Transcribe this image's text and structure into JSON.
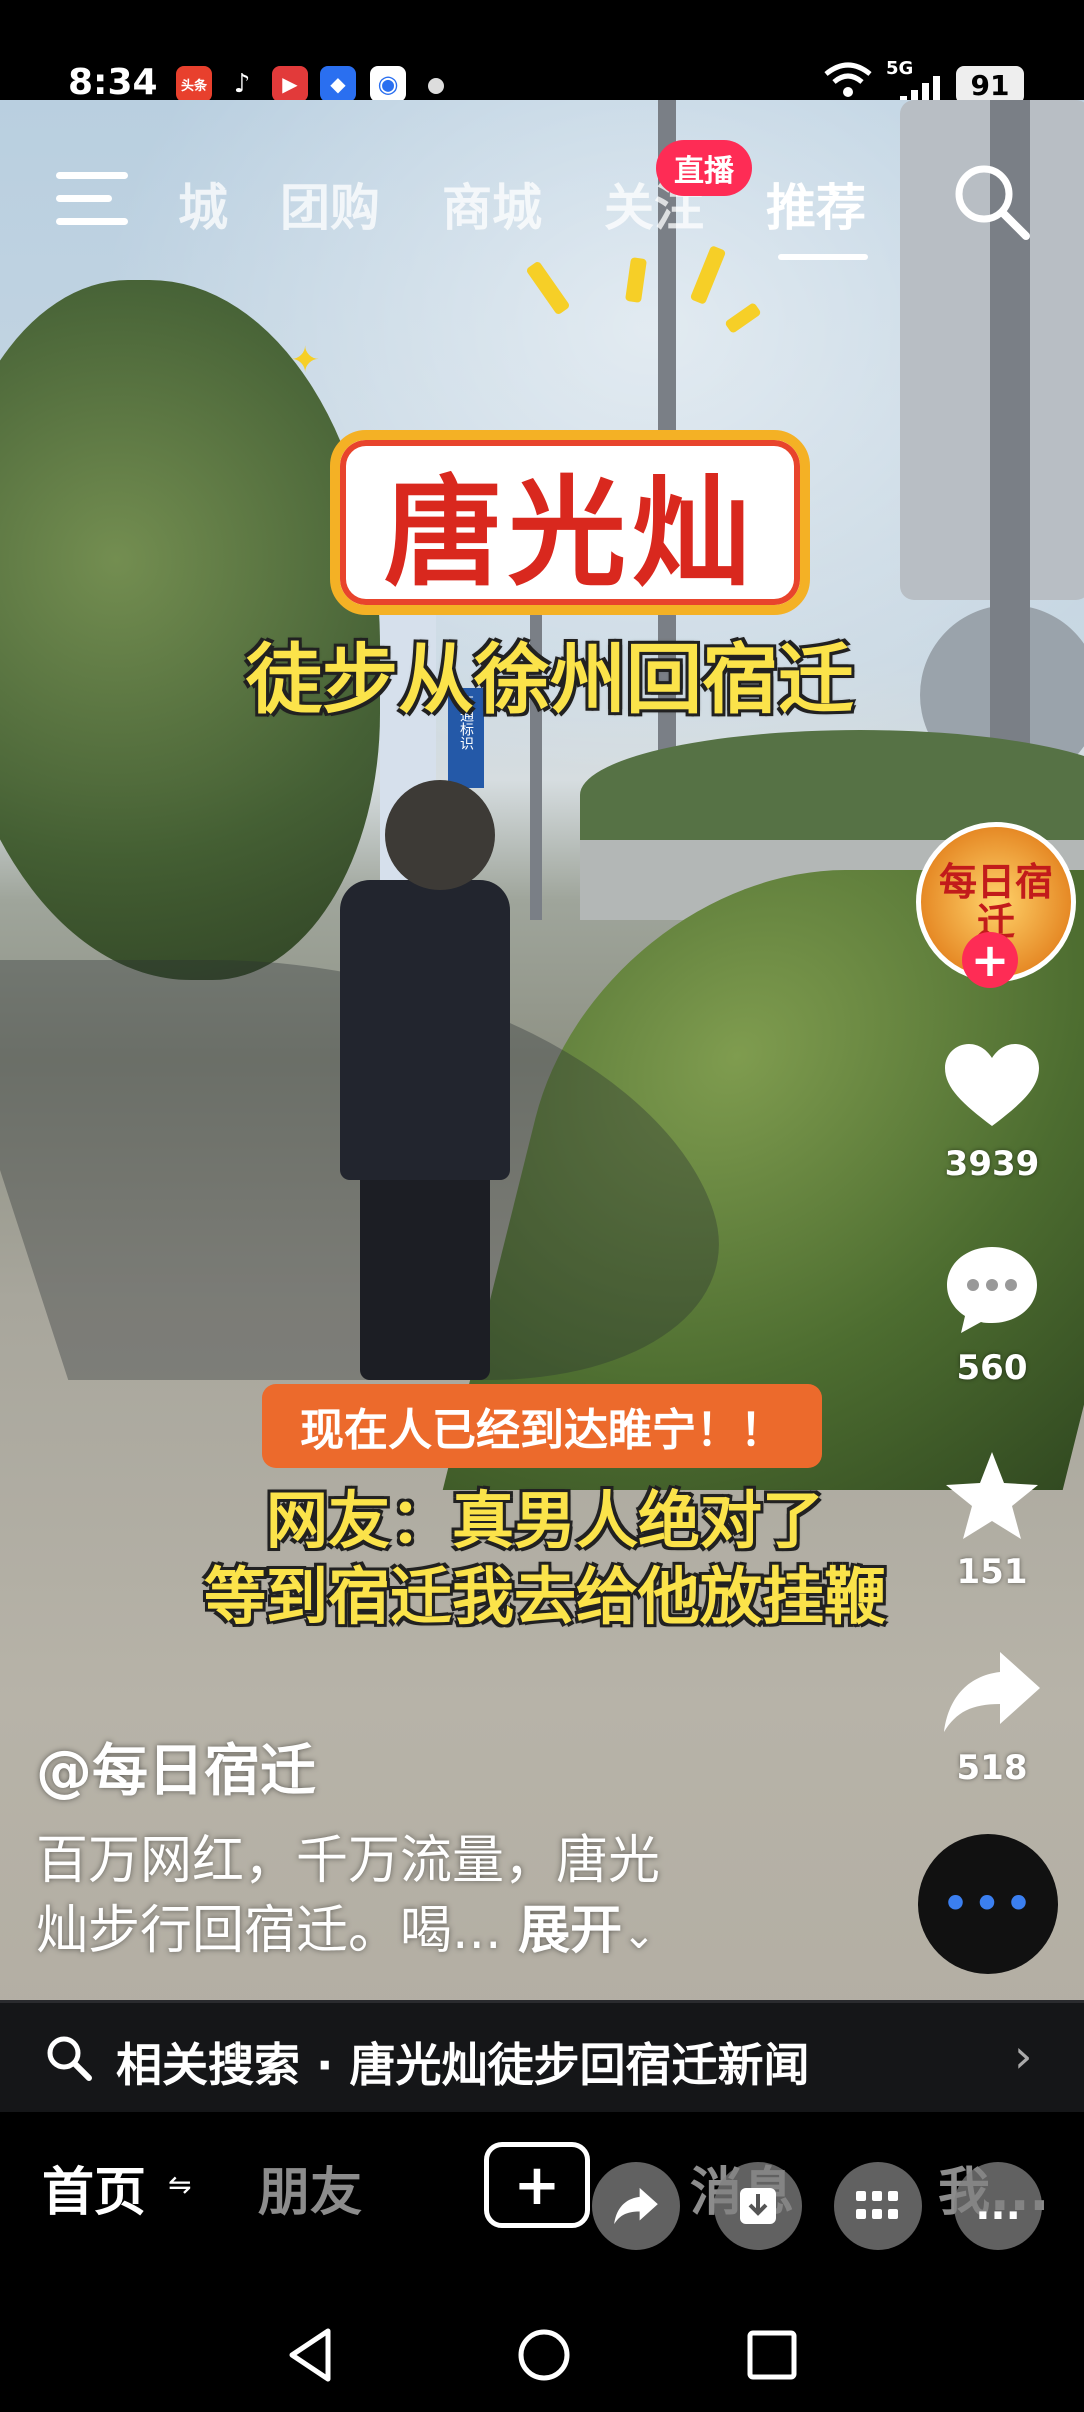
{
  "status_bar": {
    "time": "8:34",
    "app_icons": [
      {
        "name": "toutiao-icon",
        "text": "头条",
        "color": "#e8402d"
      },
      {
        "name": "tiktok-icon",
        "text": "♪",
        "color": "#000000"
      },
      {
        "name": "video-app-icon",
        "text": "▶",
        "color": "#e23a3a"
      },
      {
        "name": "blue-app-icon",
        "text": "◆",
        "color": "#2a6ff0"
      },
      {
        "name": "color-app-icon",
        "text": "◉",
        "color": "#ffffff"
      }
    ],
    "network": "5G",
    "battery": "91"
  },
  "top_nav": {
    "tabs": [
      "城",
      "团购",
      "商城",
      "关注",
      "推荐"
    ],
    "active_tab": "推荐",
    "live_badge": "直播"
  },
  "video": {
    "title": "唐光灿",
    "subtitle": "徒步从徐州回宿迁",
    "caption_box": "现在人已经到达睢宁！！",
    "caption_line1": "网友：真男人绝对了",
    "caption_line2": "等到宿迁我去给他放挂鞭",
    "scene_sign_text": "交通标识"
  },
  "sidebar": {
    "avatar_text": "每日宿迁",
    "follow_label": "+",
    "likes": "3939",
    "comments": "560",
    "favorites": "151",
    "shares": "518",
    "music_disc_text": "•••"
  },
  "post": {
    "author": "@每日宿迁",
    "description_line1": "百万网红，千万流量，唐光",
    "description_line2": "灿步行回宿迁。喝...",
    "expand_label": "展开"
  },
  "related_search": {
    "label": "相关搜索 · 唐光灿徒步回宿迁新闻"
  },
  "bottom_nav": {
    "home": "首页",
    "friends": "朋友",
    "plus": "+",
    "messages": "消息",
    "me": "我..."
  },
  "floating_actions": {
    "more_label": "..."
  },
  "colors": {
    "accent_red": "#fe2c55",
    "caption_yellow": "#fbe34a",
    "caption_orange": "#ec6a2c"
  }
}
